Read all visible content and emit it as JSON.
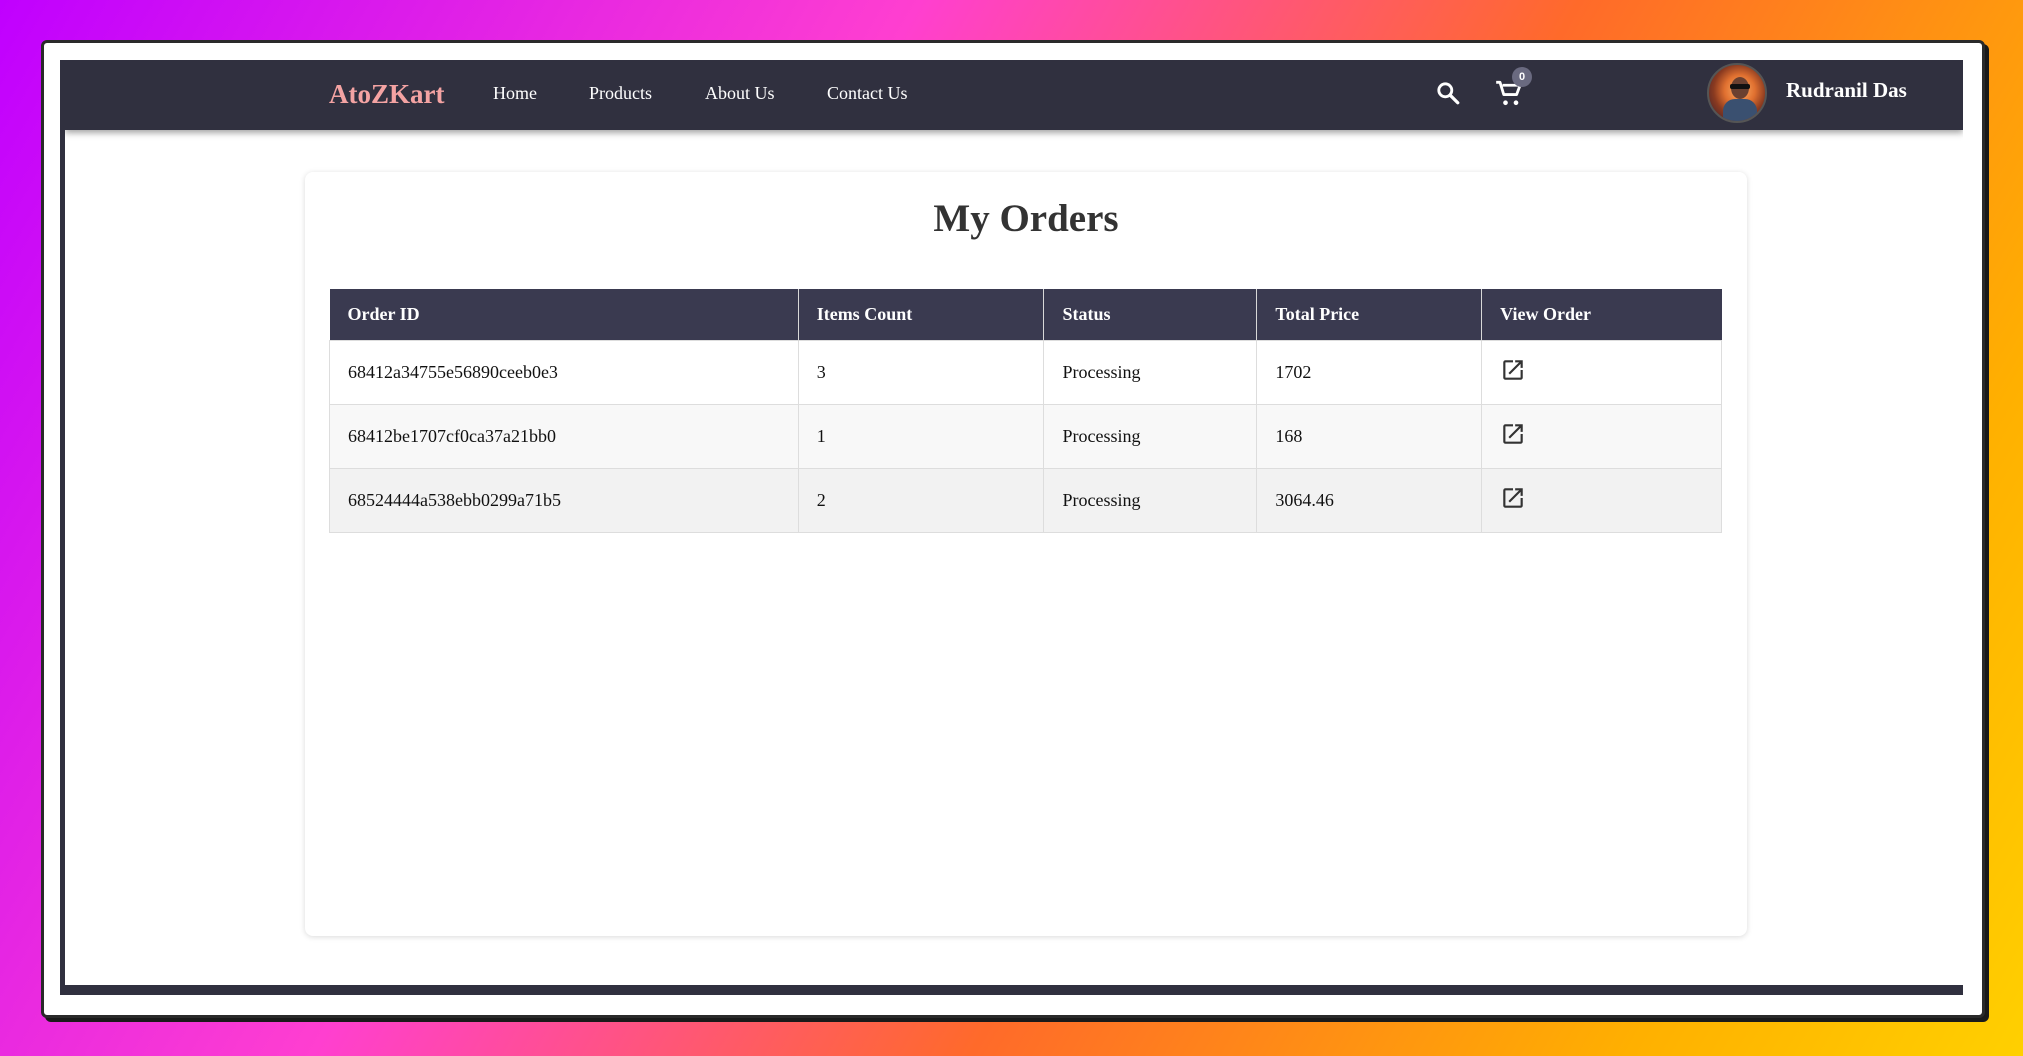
{
  "navbar": {
    "brand": "AtoZKart",
    "links": [
      "Home",
      "Products",
      "About Us",
      "Contact Us"
    ],
    "search_icon": "search-icon",
    "cart_icon": "cart-icon",
    "cart_count": "0",
    "user_name": "Rudranil Das"
  },
  "page": {
    "title": "My Orders"
  },
  "orders_table": {
    "headers": [
      "Order ID",
      "Items Count",
      "Status",
      "Total Price",
      "View Order"
    ],
    "rows": [
      {
        "order_id": "68412a34755e56890ceeb0e3",
        "items": "3",
        "status": "Processing",
        "total": "1702"
      },
      {
        "order_id": "68412be1707cf0ca37a21bb0",
        "items": "1",
        "status": "Processing",
        "total": "168"
      },
      {
        "order_id": "68524444a538ebb0299a71b5",
        "items": "2",
        "status": "Processing",
        "total": "3064.46"
      }
    ],
    "view_icon": "open-in-new-icon"
  },
  "colors": {
    "navbar_bg": "#30303f",
    "brand": "#f4a3a3",
    "table_header_bg": "#3a3a50"
  }
}
